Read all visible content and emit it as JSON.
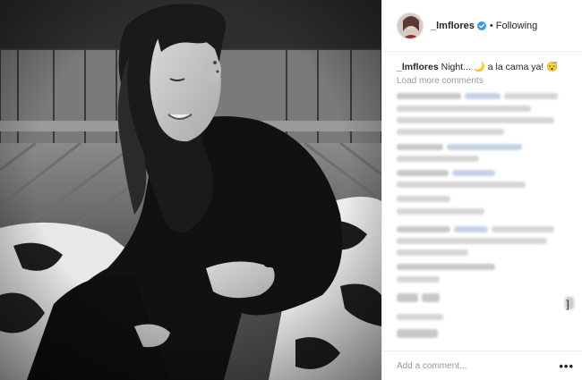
{
  "post": {
    "username": "_lmflores",
    "follow_state": "Following",
    "separator": "•"
  },
  "caption": {
    "username": "_lmflores",
    "text": "Night... 🌙 a la cama ya! 😴"
  },
  "comments": {
    "load_more": "Load more comments"
  },
  "comment_bar": {
    "placeholder": "Add a comment...",
    "more_icon": "more-options-icon"
  },
  "icons": {
    "verified": "verified-badge-icon",
    "bracket": "]"
  },
  "colors": {
    "verified_blue": "#3897f0",
    "text_primary": "#262626",
    "text_muted": "#999999",
    "divider": "#efefef"
  }
}
